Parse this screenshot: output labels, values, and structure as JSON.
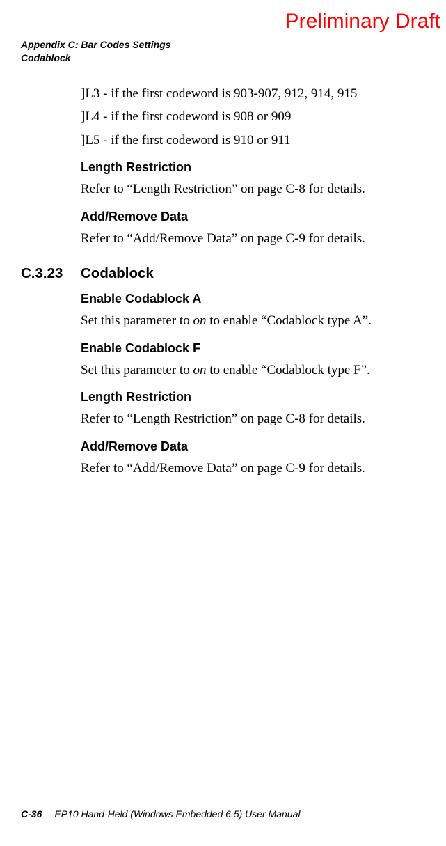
{
  "watermark": "Preliminary Draft",
  "header": {
    "line1": "Appendix C: Bar Codes Settings",
    "line2": "Codablock"
  },
  "body": {
    "l3": "]L3 - if the first codeword is 903-907, 912, 914, 915",
    "l4": "]L4 - if the first codeword is 908 or 909",
    "l5": "]L5 - if the first codeword is 910 or 911",
    "lengthRestrictionHeading1": "Length Restriction",
    "lengthRestrictionText1": "Refer to “Length Restriction” on page C-8 for details.",
    "addRemoveHeading1": "Add/Remove Data",
    "addRemoveText1": "Refer to “Add/Remove Data” on page C-9 for details.",
    "sectionNumber": "C.3.23",
    "sectionTitle": "Codablock",
    "enableAHeading": "Enable Codablock A",
    "enableA_pre": "Set this parameter to ",
    "enableA_em": "on",
    "enableA_post": " to enable “Codablock type A”.",
    "enableFHeading": "Enable Codablock F",
    "enableF_pre": "Set this parameter to ",
    "enableF_em": "on",
    "enableF_post": " to enable “Codablock type F”.",
    "lengthRestrictionHeading2": "Length Restriction",
    "lengthRestrictionText2": "Refer to “Length Restriction” on page C-8 for details.",
    "addRemoveHeading2": "Add/Remove Data",
    "addRemoveText2": "Refer to “Add/Remove Data” on page C-9 for details."
  },
  "footer": {
    "pageNumber": "C-36",
    "manualTitle": "EP10 Hand-Held (Windows Embedded 6.5) User Manual"
  }
}
